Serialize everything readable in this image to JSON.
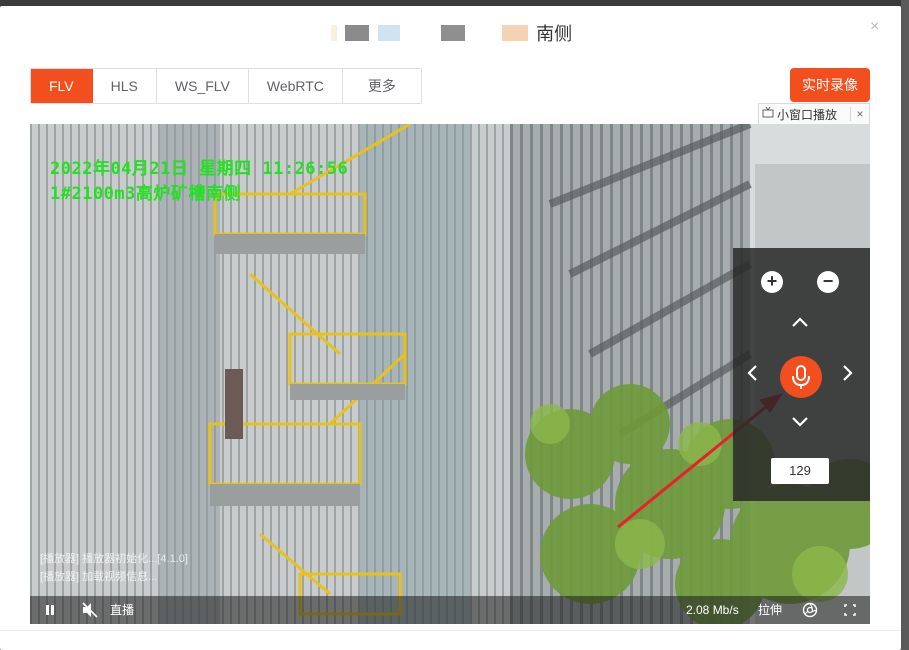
{
  "dialog": {
    "title": "南侧",
    "close_label": "×"
  },
  "tabs": [
    {
      "label": "FLV",
      "active": true
    },
    {
      "label": "HLS",
      "active": false
    },
    {
      "label": "WS_FLV",
      "active": false
    },
    {
      "label": "WebRTC",
      "active": false
    },
    {
      "label": "更多",
      "active": false
    }
  ],
  "record_button": "实时录像",
  "mini_window": {
    "icon": "tv-icon",
    "label": "小窗口播放",
    "close_label": "×"
  },
  "video": {
    "osd_datetime": "2022年04月21日 星期四 11:26:56",
    "osd_location": "1#2100m3高炉矿槽南侧",
    "logs": [
      "[播放器] 播放器初始化...[4.1.0]",
      "[播放器] 加载视频信息..."
    ]
  },
  "ptz": {
    "zoom_in": "+",
    "zoom_out": "−",
    "up": "⌃",
    "down": "⌄",
    "left": "‹",
    "right": "›",
    "speed_value": "129",
    "mic_icon": "microphone-icon"
  },
  "controls": {
    "pause_icon": "pause-icon",
    "mute_icon": "muted-speaker-icon",
    "live_label": "直播",
    "bitrate": "2.08 Mb/s",
    "stretch_label": "拉伸",
    "screenshot_icon": "camera-shutter-icon",
    "fullscreen_icon": "fullscreen-icon"
  },
  "colors": {
    "accent": "#f24e1e",
    "osd_text": "#23e023",
    "annotation_arrow": "#e8202a"
  }
}
